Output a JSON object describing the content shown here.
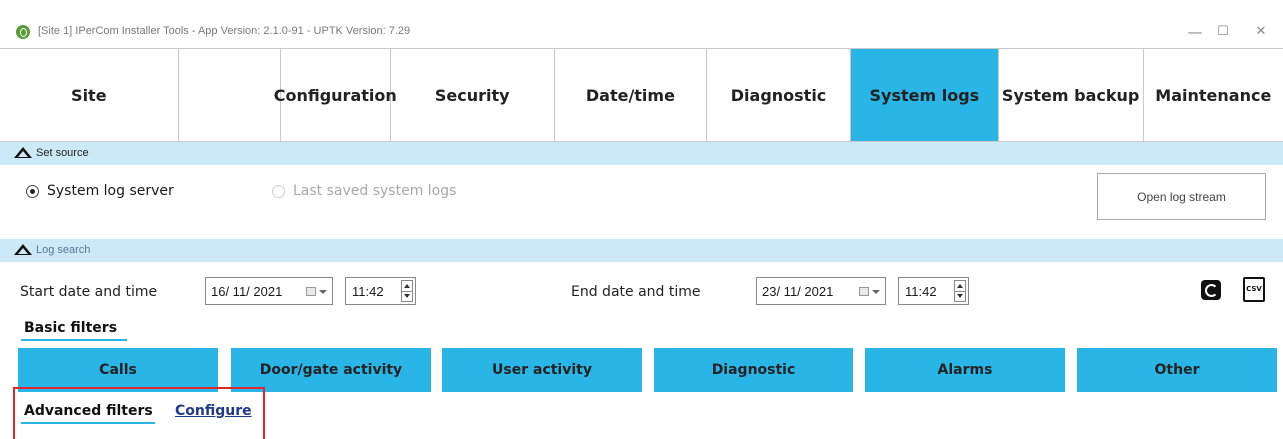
{
  "window": {
    "title": "[Site 1] IPerCom Installer Tools - App Version: 2.1.0-91 - UPTK Version: 7.29",
    "minimize": "—",
    "maximize": "☐",
    "close": "✕"
  },
  "tabs": [
    {
      "label": "Site"
    },
    {
      "label": "Configuration"
    },
    {
      "label": "Security"
    },
    {
      "label": "Date/time"
    },
    {
      "label": "Diagnostic"
    },
    {
      "label": "System logs",
      "active": true
    },
    {
      "label": "System backup"
    },
    {
      "label": "Maintenance"
    }
  ],
  "set_source": {
    "header": "Set source",
    "options": [
      {
        "label": "System log server",
        "selected": true,
        "enabled": true
      },
      {
        "label": "Last saved system logs",
        "selected": false,
        "enabled": false
      }
    ],
    "open_stream_button": "Open log stream"
  },
  "log_search": {
    "header": "Log search",
    "start_label": "Start date and time",
    "start_date": "16/ 11/ 2021",
    "start_time": "11:42",
    "end_label": "End date and time",
    "end_date": "23/ 11/ 2021",
    "end_time": "11:42",
    "refresh_icon": "refresh-icon",
    "csv_icon": "csv-export-icon",
    "csv_text": "CSV"
  },
  "basic_filters": {
    "title": "Basic filters",
    "buttons": [
      "Calls",
      "Door/gate activity",
      "User activity",
      "Diagnostic",
      "Alarms",
      "Other"
    ]
  },
  "advanced_filters": {
    "title": "Advanced filters",
    "configure_link": "Configure"
  },
  "colors": {
    "accent": "#29b6e6",
    "section_header": "#cbe9f6",
    "highlight": "#e0262b"
  }
}
